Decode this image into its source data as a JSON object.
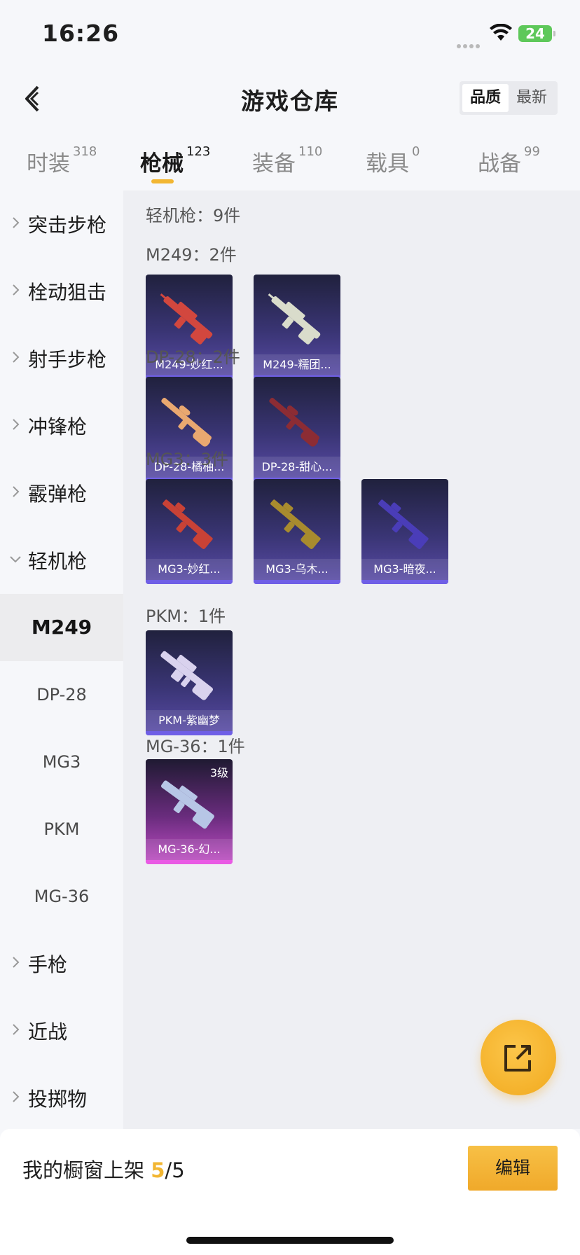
{
  "status_bar": {
    "time": "16:26",
    "battery": "24",
    "icons": [
      "signal-dots-icon",
      "wifi-icon",
      "battery-icon"
    ]
  },
  "header": {
    "title": "游戏仓库",
    "back_icon": "chevron-left-icon",
    "sort": {
      "quality": "品质",
      "newest": "最新"
    }
  },
  "tabs": [
    {
      "label": "时装",
      "count": "318"
    },
    {
      "label": "枪械",
      "count": "123",
      "active": true
    },
    {
      "label": "装备",
      "count": "110"
    },
    {
      "label": "载具",
      "count": "0"
    },
    {
      "label": "战备",
      "count": "99"
    }
  ],
  "sidebar": {
    "categories": [
      {
        "label": "突击步枪"
      },
      {
        "label": "栓动狙击"
      },
      {
        "label": "射手步枪"
      },
      {
        "label": "冲锋枪"
      },
      {
        "label": "霰弹枪"
      },
      {
        "label": "轻机枪",
        "expanded": true
      }
    ],
    "subitems": [
      {
        "label": "M249",
        "active": true
      },
      {
        "label": "DP-28"
      },
      {
        "label": "MG3"
      },
      {
        "label": "PKM"
      },
      {
        "label": "MG-36"
      }
    ],
    "categories_after": [
      {
        "label": "手枪"
      },
      {
        "label": "近战"
      },
      {
        "label": "投掷物"
      }
    ]
  },
  "main": {
    "summary": "轻机枪：9件",
    "groups": [
      {
        "heading": "M249：2件",
        "items": [
          {
            "name": "M249-妙红...",
            "gun_color": "#d2473e"
          },
          {
            "name": "M249-糯团...",
            "gun_color": "#d9dccb"
          }
        ]
      },
      {
        "heading": "DP-28：2件",
        "items": [
          {
            "name": "DP-28-橘柚...",
            "gun_color": "#e9a870"
          },
          {
            "name": "DP-28-甜心...",
            "gun_color": "#8c2c34"
          }
        ]
      },
      {
        "heading": "MG3：3件",
        "items": [
          {
            "name": "MG3-妙红...",
            "gun_color": "#c94236"
          },
          {
            "name": "MG3-乌木...",
            "gun_color": "#a88b2e"
          },
          {
            "name": "MG3-暗夜...",
            "gun_color": "#4a3db8"
          }
        ]
      },
      {
        "heading": "PKM：1件",
        "items": [
          {
            "name": "PKM-紫幽梦",
            "gun_color": "#d9d2ee"
          }
        ]
      },
      {
        "heading": "MG-36：1件",
        "items": [
          {
            "name": "MG-36-幻...",
            "gun_color": "#b7c6e6",
            "level": "3级",
            "rarity": "pink"
          }
        ]
      }
    ]
  },
  "fab": {
    "icon": "share-out-icon"
  },
  "bottom": {
    "shelf_label": "我的橱窗上架",
    "shelf_count": "5",
    "shelf_total": "/5",
    "edit_label": "编辑"
  },
  "colors": {
    "accent": "#f2b632",
    "card_purple": "#5a4ca8",
    "card_pink": "#c04ec4"
  }
}
